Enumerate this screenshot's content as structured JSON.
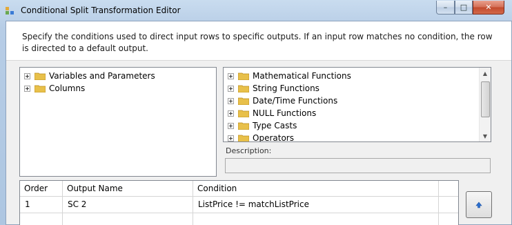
{
  "window": {
    "title": "Conditional Split Transformation Editor",
    "controls": {
      "minimize": "–",
      "maximize": "□",
      "close": "✕"
    }
  },
  "instructions": "Specify the conditions used to direct input rows to specific outputs. If an input row matches no condition, the row is directed to a default output.",
  "left_tree": {
    "items": [
      {
        "label": "Variables and Parameters",
        "icon": "folder-icon"
      },
      {
        "label": "Columns",
        "icon": "folder-icon"
      }
    ]
  },
  "right_tree": {
    "items": [
      {
        "label": "Mathematical Functions",
        "icon": "folder-icon"
      },
      {
        "label": "String Functions",
        "icon": "folder-icon"
      },
      {
        "label": "Date/Time Functions",
        "icon": "folder-icon"
      },
      {
        "label": "NULL Functions",
        "icon": "folder-icon"
      },
      {
        "label": "Type Casts",
        "icon": "folder-icon"
      },
      {
        "label": "Operators",
        "icon": "folder-icon"
      }
    ]
  },
  "description": {
    "label": "Description:",
    "value": ""
  },
  "grid": {
    "columns": [
      "Order",
      "Output Name",
      "Condition"
    ],
    "rows": [
      {
        "order": "1",
        "output_name": "SC 2",
        "condition": "ListPrice != matchListPrice"
      }
    ]
  },
  "colors": {
    "folder": "#e8c04a",
    "titlebar": "#b9d0e8",
    "close": "#c75034",
    "up_arrow": "#2a6fd1"
  }
}
